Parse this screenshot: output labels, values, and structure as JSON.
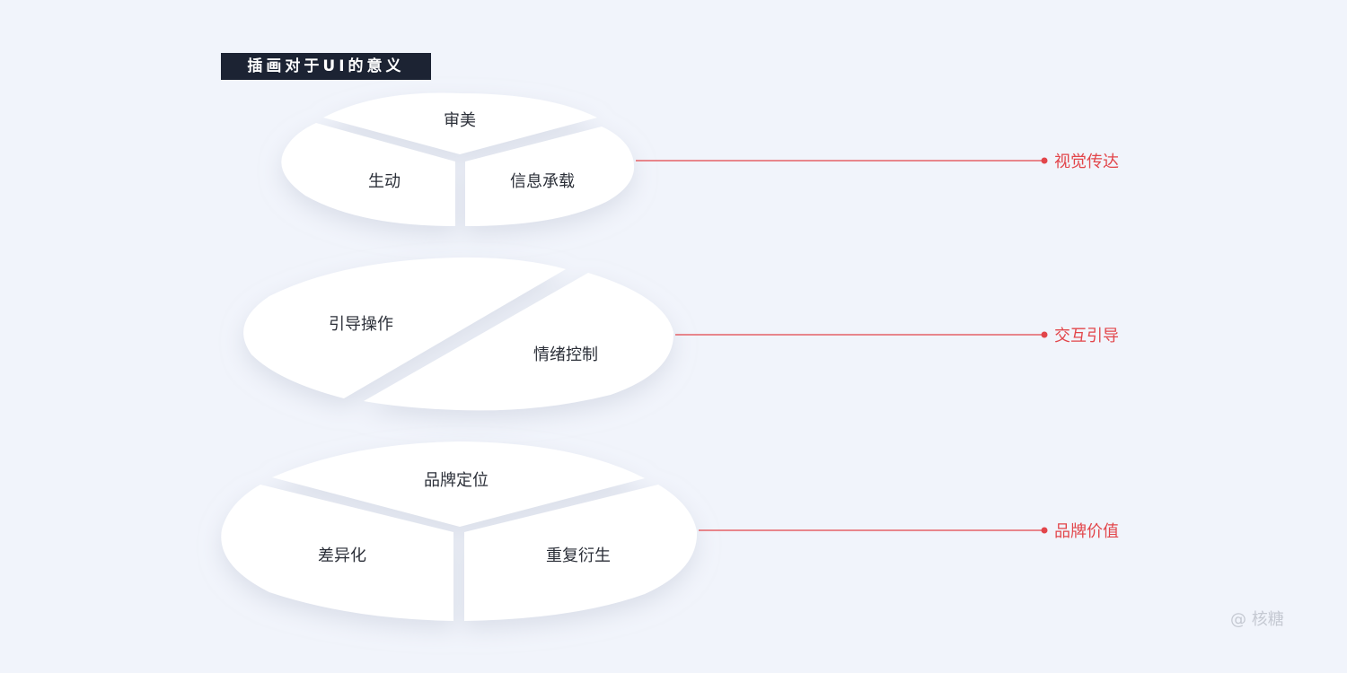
{
  "title": "插画对于UI的意义",
  "groups": [
    {
      "category": "视觉传达",
      "segments": [
        "审美",
        "生动",
        "信息承载"
      ]
    },
    {
      "category": "交互引导",
      "segments": [
        "引导操作",
        "情绪控制"
      ]
    },
    {
      "category": "品牌价值",
      "segments": [
        "品牌定位",
        "差异化",
        "重复衍生"
      ]
    }
  ],
  "watermark": "@ 核糖",
  "colors": {
    "background": "#f1f4fb",
    "badge": "#1c2333",
    "accent": "#e2454a",
    "slice": "#ffffff"
  }
}
